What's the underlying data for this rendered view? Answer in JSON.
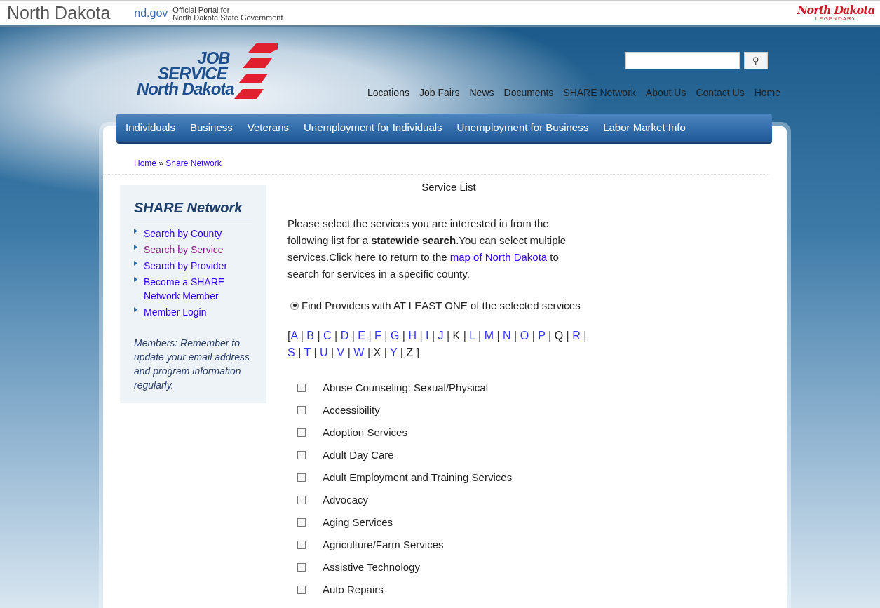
{
  "portal_bar": {
    "state_name": "North Dakota",
    "domain": "nd.gov",
    "tagline_lines": [
      "Official Portal for",
      "North Dakota State Government"
    ],
    "brand": {
      "script": "North Dakota",
      "caption": "LEGENDARY"
    }
  },
  "header": {
    "logo_lines": [
      "JOB",
      "SERVICE",
      "North Dakota"
    ],
    "search": {
      "button": "⚲"
    },
    "top_links": [
      "Locations",
      "Job Fairs",
      "News",
      "Documents",
      "SHARE Network",
      "About Us",
      "Contact Us",
      "Home"
    ]
  },
  "main_nav": [
    "Individuals",
    "Business",
    "Veterans",
    "Unemployment for Individuals",
    "Unemployment for Business",
    "Labor Market Info"
  ],
  "breadcrumb": {
    "items": [
      "Home",
      "Share Network"
    ],
    "separator": "»"
  },
  "sidebar": {
    "title": "SHARE Network",
    "items": [
      {
        "label": "Search by County",
        "visited": false
      },
      {
        "label": "Search by Service",
        "visited": true
      },
      {
        "label": "Search by Provider",
        "visited": false
      },
      {
        "label": "Become a SHARE Network Member",
        "visited": false
      },
      {
        "label": "Member Login",
        "visited": false
      }
    ],
    "note": "Members: Remember to update your email address and program information regularly."
  },
  "content": {
    "title": "Service List",
    "intro": {
      "before": "Please select the services you are interested in from the following list for a **statewide search**.You can select multiple services.Click here to return to the ",
      "link": "map of North Dakota",
      "after": " to search for services in a specific county."
    },
    "radio": {
      "label": "Find Providers with AT LEAST ONE of the selected services",
      "selected": true
    },
    "alphabet": {
      "open": "[",
      "close": "]",
      "separator": "|",
      "letters": [
        {
          "letter": "A",
          "link": true
        },
        {
          "letter": "B",
          "link": true
        },
        {
          "letter": "C",
          "link": true
        },
        {
          "letter": "D",
          "link": true
        },
        {
          "letter": "E",
          "link": true
        },
        {
          "letter": "F",
          "link": true
        },
        {
          "letter": "G",
          "link": true
        },
        {
          "letter": "H",
          "link": true
        },
        {
          "letter": "I",
          "link": true
        },
        {
          "letter": "J",
          "link": true
        },
        {
          "letter": "K",
          "link": false
        },
        {
          "letter": "L",
          "link": true
        },
        {
          "letter": "M",
          "link": true
        },
        {
          "letter": "N",
          "link": true
        },
        {
          "letter": "O",
          "link": true
        },
        {
          "letter": "P",
          "link": true
        },
        {
          "letter": "Q",
          "link": false
        },
        {
          "letter": "R",
          "link": true
        },
        {
          "letter": "S",
          "link": true
        },
        {
          "letter": "T",
          "link": true
        },
        {
          "letter": "U",
          "link": true
        },
        {
          "letter": "V",
          "link": true
        },
        {
          "letter": "W",
          "link": true
        },
        {
          "letter": "X",
          "link": false
        },
        {
          "letter": "Y",
          "link": true
        },
        {
          "letter": "Z",
          "link": false
        }
      ]
    },
    "services": [
      {
        "label": "Abuse Counseling: Sexual/Physical",
        "checked": false
      },
      {
        "label": "Accessibility",
        "checked": false
      },
      {
        "label": "Adoption Services",
        "checked": false
      },
      {
        "label": "Adult Day Care",
        "checked": false
      },
      {
        "label": "Adult Employment and Training Services",
        "checked": false
      },
      {
        "label": "Advocacy",
        "checked": false
      },
      {
        "label": "Aging Services",
        "checked": false
      },
      {
        "label": "Agriculture/Farm Services",
        "checked": false
      },
      {
        "label": "Assistive Technology",
        "checked": false
      },
      {
        "label": "Auto Repairs",
        "checked": false
      }
    ]
  }
}
